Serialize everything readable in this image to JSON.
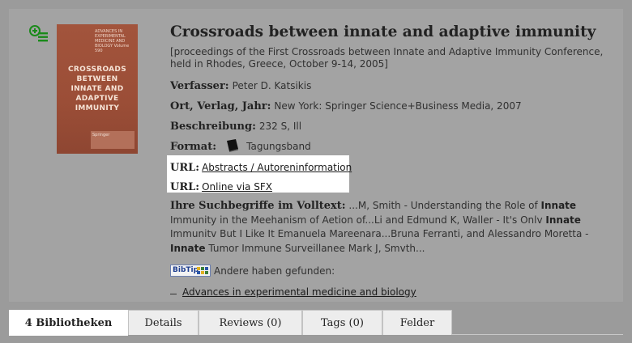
{
  "record": {
    "title": "Crossroads between innate and adaptive immunity",
    "subtitle": "[proceedings of the First Crossroads between Innate and Adaptive Immunity Conference, held in Rhodes, Greece, October 9-14, 2005]",
    "fields": {
      "author_label": "Verfasser:",
      "author_value": "Peter D. Katsikis",
      "publisher_label": "Ort, Verlag, Jahr:",
      "publisher_value": "New York: Springer Science+Business Media, 2007",
      "description_label": "Beschreibung:",
      "description_value": "232 S, Ill",
      "format_label": "Format:",
      "format_value": "Tagungsband"
    },
    "urls": [
      {
        "label": "URL:",
        "link": "Abstracts / Autoreninformation"
      },
      {
        "label": "URL:",
        "link": "Online via SFX"
      }
    ],
    "fulltext": {
      "label": "Ihre Suchbegriffe im Volltext:",
      "seg1": " ...M, Smith - Understanding the Role of ",
      "hit1": "Innate",
      "seg2": " Immunity in the Meehanism of Aetion of...Li and Edmund K, Waller - It's Onlv ",
      "hit2": "Innate",
      "seg3": " Immunitv But I Like It Emanuela Mareenara...Bruna Ferranti, and Alessandro Moretta - ",
      "hit3": "Innate",
      "seg4": " Tumor Immune Surveillanee Mark J, Smvth..."
    },
    "bibtip": {
      "logo_text": "BibTip",
      "label": "Andere haben gefunden:",
      "related_link": "Advances in experimental medicine and biology"
    },
    "cover": {
      "series": "ADVANCES IN EXPERIMENTAL MEDICINE AND BIOLOGY Volume 590",
      "title": "CROSSROADS BETWEEN INNATE AND ADAPTIVE IMMUNITY",
      "publisher": "Springer"
    }
  },
  "tabs": [
    {
      "label": "4 Bibliotheken",
      "active": true
    },
    {
      "label": "Details",
      "active": false
    },
    {
      "label": "Reviews (0)",
      "active": false
    },
    {
      "label": "Tags (0)",
      "active": false
    },
    {
      "label": "Felder",
      "active": false
    }
  ],
  "icons": {
    "add": "add-to-list-icon",
    "format": "book-icon"
  },
  "colors": {
    "background": "#9b9b9b",
    "panel": "#a3a3a3",
    "add_icon": "#1a8a1a",
    "cover": "#9b4e37",
    "active_tab": "#ffffff",
    "inactive_tab": "#ededed"
  }
}
